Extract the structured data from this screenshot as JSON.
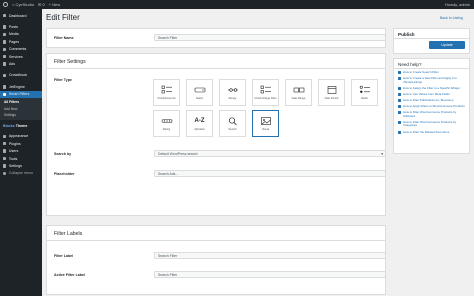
{
  "admin_bar": {
    "site_name": "CyeStudio",
    "comments_count": "0",
    "new_label": "+ New",
    "greeting": "Howdy, admin"
  },
  "sidebar": {
    "items": [
      {
        "label": "Dashboard"
      },
      {
        "label": "Posts"
      },
      {
        "label": "Media"
      },
      {
        "label": "Pages"
      },
      {
        "label": "Comments"
      },
      {
        "label": "Services"
      },
      {
        "label": "Ads"
      },
      {
        "label": "Crowdbook"
      },
      {
        "label": "JetEngine"
      },
      {
        "label": "Smart Filters"
      }
    ],
    "submenu": [
      "All Filters",
      "Add New",
      "Settings"
    ],
    "theme_brand": "Blocks",
    "theme_label": "Theme",
    "bottom_items": [
      {
        "label": "Appearance"
      },
      {
        "label": "Plugins"
      },
      {
        "label": "Users"
      },
      {
        "label": "Tools"
      },
      {
        "label": "Settings"
      }
    ],
    "collapse_label": "Collapse menu"
  },
  "header": {
    "title": "Edit Filter",
    "back_link": "Back to Listing"
  },
  "filter_name": {
    "label": "Filter Name",
    "placeholder": "Search Filter"
  },
  "settings": {
    "title": "Filter Settings",
    "type_label": "Filter Type",
    "types": [
      {
        "label": "Checkboxes list"
      },
      {
        "label": "Select"
      },
      {
        "label": "Range"
      },
      {
        "label": "Check Range Filter"
      },
      {
        "label": "Date Range"
      },
      {
        "label": "Date Period"
      },
      {
        "label": "Radio"
      },
      {
        "label": "Rating"
      },
      {
        "label": "Alphabet"
      },
      {
        "label": "Search"
      },
      {
        "label": "Visual"
      }
    ],
    "search_by_label": "Search by",
    "search_by_value": "Default WordPress search",
    "placeholder_label": "Placeholder",
    "placeholder_value": "Search Ads..."
  },
  "labels": {
    "title": "Filter Labels",
    "filter_label": "Filter Label",
    "filter_label_value": "Search Filter",
    "active_label": "Active Filter Label",
    "active_label_value": "Search Filter"
  },
  "publish": {
    "title": "Publish",
    "button": "Update"
  },
  "help": {
    "title": "Need help?",
    "links": [
      "How to Create Search Filter",
      "How to Create a New Filter and Apply It to JSmartListings",
      "How to Assign the Filter to a Specific Widget",
      "How to Use Values from Meta Fields",
      "How to Filter Publications by Taxonomy",
      "How to Apply Filters to WooCommerce Products",
      "How to Filter WooCommerce Products by Attributes",
      "How to Filter WooCommerce Products by Categories",
      "How to Filter the Related Post Items"
    ]
  },
  "colors": {
    "accent": "#2271b1",
    "sidebar_bg": "#1d2327",
    "page_bg": "#f0f0f1"
  }
}
